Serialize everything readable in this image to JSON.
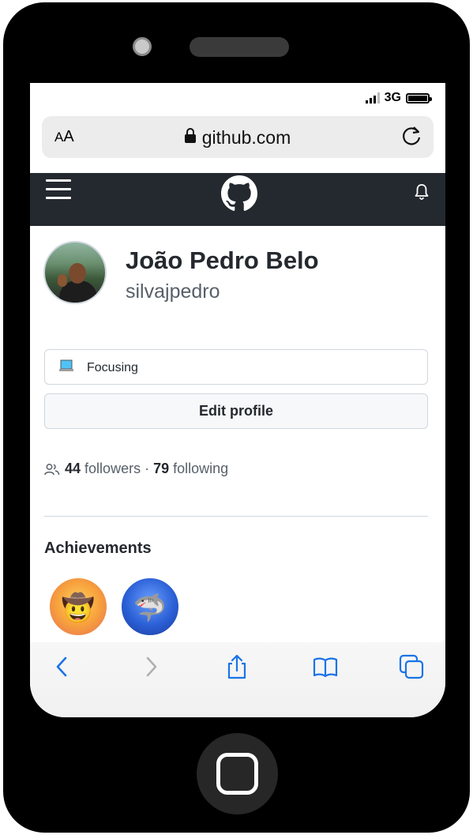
{
  "status_bar": {
    "network": "3G"
  },
  "browser": {
    "aa_small": "A",
    "aa_large": "A",
    "url": "github.com"
  },
  "profile": {
    "name": "João Pedro Belo",
    "login": "silvajpedro",
    "status": "Focusing",
    "edit_button": "Edit profile",
    "followers_count": "44",
    "followers_label": "followers",
    "separator": "·",
    "following_count": "79",
    "following_label": "following"
  },
  "achievements": {
    "title": "Achievements",
    "badges": [
      {
        "name": "cowboy-badge",
        "emoji": "🤠"
      },
      {
        "name": "shark-badge",
        "emoji": "🦈"
      }
    ]
  },
  "colors": {
    "header_bg": "#24292f",
    "text_primary": "#24292f",
    "text_muted": "#57606a",
    "link_blue": "#0969da"
  },
  "icons": [
    "hamburger-icon",
    "github-logo-icon",
    "bell-icon",
    "lock-icon",
    "reload-icon",
    "people-icon",
    "laptop-icon",
    "back-icon",
    "forward-icon",
    "share-icon",
    "bookmarks-icon",
    "tabs-icon"
  ]
}
